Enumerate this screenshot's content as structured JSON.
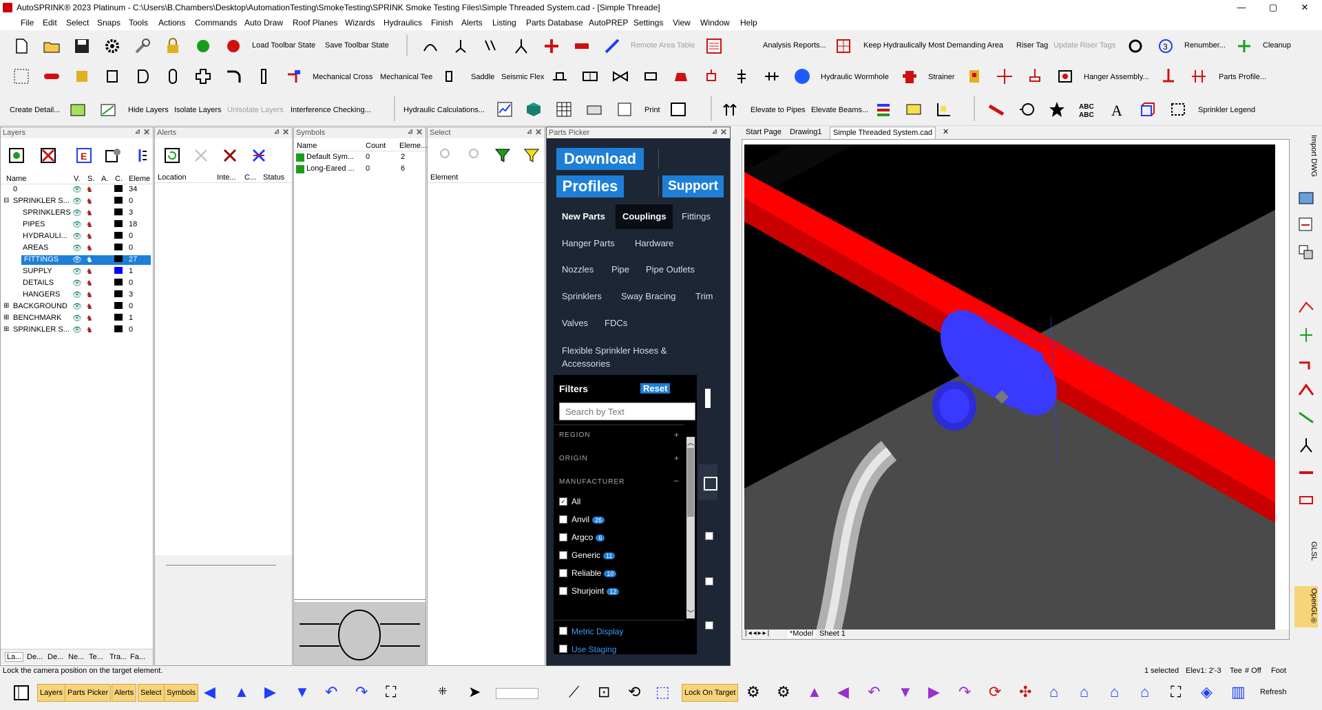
{
  "window": {
    "title": "AutoSPRINK® 2023 Platinum - C:\\Users\\B.Chambers\\Desktop\\AutomationTesting\\SmokeTesting\\SPRINK Smoke Testing Files\\Simple Threaded System.cad - [Simple Threade]",
    "min": "—",
    "max": "▢",
    "close": "✕"
  },
  "menu": [
    "File",
    "Edit",
    "Select",
    "Snaps",
    "Tools",
    "Actions",
    "Commands",
    "Auto Draw",
    "Roof Planes",
    "Wizards",
    "Hydraulics",
    "Finish",
    "Alerts",
    "Listing",
    "Parts Database",
    "AutoPREP",
    "Settings",
    "View",
    "Window",
    "Help"
  ],
  "toolbar1": {
    "load_state": "Load Toolbar State",
    "save_state": "Save Toolbar State",
    "remote_area": "Remote Area Table",
    "analysis": "Analysis Reports...",
    "keep_hyd": "Keep Hydraulically Most Demanding Area",
    "riser_tag": "Riser Tag",
    "update_riser": "Update Riser Tags",
    "renumber": "Renumber...",
    "cleanup": "Cleanup"
  },
  "toolbar2": {
    "mech_cross": "Mechanical Cross",
    "mech_tee": "Mechanical Tee",
    "saddle": "Saddle",
    "seismic_flex": "Seismic Flex",
    "hyd_wormhole": "Hydraulic Wormhole",
    "strainer": "Strainer",
    "hanger_assembly": "Hanger Assembly...",
    "parts_profile": "Parts Profile..."
  },
  "toolbar3": {
    "create_detail": "Create Detail...",
    "hide_layers": "Hide Layers",
    "isolate_layers": "Isolate Layers",
    "unisolate_layers": "Unisolate Layers",
    "interference": "Interference Checking...",
    "hyd_calc": "Hydraulic Calculations...",
    "print": "Print",
    "elevate_pipes": "Elevate to Pipes",
    "elevate_beams": "Elevate Beams...",
    "sprinkler_legend": "Sprinkler Legend"
  },
  "layers": {
    "title": "Layers",
    "columns": [
      "Name",
      "V.",
      "S.",
      "A.",
      "C.",
      "Eleme"
    ],
    "rows": [
      {
        "name": "0",
        "count": "34",
        "color": "#000000",
        "expander": ""
      },
      {
        "name": "SPRINKLER S...",
        "count": "0",
        "color": "#000000",
        "expander": "⊟"
      },
      {
        "name": "SPRINKLERS",
        "count": "3",
        "color": "#000000",
        "expander": ""
      },
      {
        "name": "PIPES",
        "count": "18",
        "color": "#000000",
        "expander": ""
      },
      {
        "name": "HYDRAULI...",
        "count": "0",
        "color": "#000000",
        "expander": ""
      },
      {
        "name": "AREAS",
        "count": "0",
        "color": "#000000",
        "expander": ""
      },
      {
        "name": "FITTINGS",
        "count": "27",
        "color": "#000000",
        "expander": ""
      },
      {
        "name": "SUPPLY",
        "count": "1",
        "color": "#0000ff",
        "expander": ""
      },
      {
        "name": "DETAILS",
        "count": "0",
        "color": "#000000",
        "expander": ""
      },
      {
        "name": "HANGERS",
        "count": "3",
        "color": "#000000",
        "expander": ""
      },
      {
        "name": "BACKGROUND",
        "count": "0",
        "color": "#000000",
        "expander": "⊞"
      },
      {
        "name": "BENCHMARK",
        "count": "1",
        "color": "#000000",
        "expander": "⊞"
      },
      {
        "name": "SPRINKLER S...",
        "count": "0",
        "color": "#000000",
        "expander": "⊞"
      }
    ],
    "bottom_tabs": [
      "La...",
      "De...",
      "De...",
      "Ne...",
      "Te...",
      "Tra...",
      "Fa..."
    ]
  },
  "alerts": {
    "title": "Alerts",
    "columns": [
      "Location",
      "Inte...",
      "C...",
      "Status"
    ]
  },
  "symbols": {
    "title": "Symbols",
    "columns": [
      "Name",
      "Count",
      "Eleme..."
    ],
    "rows": [
      {
        "name": "Default Sym...",
        "count": "0",
        "elements": "2"
      },
      {
        "name": "Long-Eared ...",
        "count": "0",
        "elements": "6"
      }
    ]
  },
  "select": {
    "title": "Select",
    "columns": [
      "Element"
    ]
  },
  "parts_picker": {
    "title": "Parts Picker",
    "download": "Download",
    "profiles": "Profiles",
    "support": "Support",
    "categories": [
      "New Parts",
      "Couplings",
      "Fittings",
      "Hanger Parts",
      "Hardware",
      "Nozzles",
      "Pipe",
      "Pipe Outlets",
      "Sprinklers",
      "Sway Bracing",
      "Trim",
      "Valves",
      "FDCs",
      "Flexible Sprinkler Hoses & Accessories"
    ],
    "filters_label": "Filters",
    "reset": "Reset",
    "search_placeholder": "Search by Text",
    "region": "REGION",
    "origin": "ORIGIN",
    "manufacturer": "MANUFACTURER",
    "manufacturers": [
      {
        "name": "All",
        "count": "",
        "checked": true
      },
      {
        "name": "Anvil",
        "count": "26",
        "checked": false
      },
      {
        "name": "Argco",
        "count": "6",
        "checked": false
      },
      {
        "name": "Generic",
        "count": "11",
        "checked": false
      },
      {
        "name": "Reliable",
        "count": "10",
        "checked": false
      },
      {
        "name": "Shurjoint",
        "count": "12",
        "checked": false
      }
    ],
    "metric_display": "Metric Display",
    "use_staging": "Use Staging"
  },
  "doc_tabs": [
    "Start Page",
    "Drawing1",
    "Simple Threaded System.cad"
  ],
  "model_tabs": [
    "*Model",
    "Sheet 1"
  ],
  "right_sidebar": {
    "import_dwg": "Import DWG",
    "glsl": "GLSL",
    "opengl": "OpenGL®"
  },
  "status": {
    "message": "Lock the camera position on the target element.",
    "selected": "1 selected",
    "elev": "Elev1: 2'-3",
    "tee": "Tee",
    "off": "# Off",
    "foot": "Foot"
  },
  "bottom_toolbar": {
    "layers": "Layers",
    "parts_picker": "Parts Picker",
    "alerts": "Alerts",
    "select": "Select",
    "symbols": "Symbols",
    "lock_on_target": "Lock On Target",
    "refresh": "Refresh"
  },
  "colors": {
    "pipe_red": "#ff0000",
    "fitting_blue": "#3a3aff",
    "pp_bg": "#1d2635",
    "accent": "#1e7fd8",
    "bottom_highlight": "#f7d37a"
  }
}
